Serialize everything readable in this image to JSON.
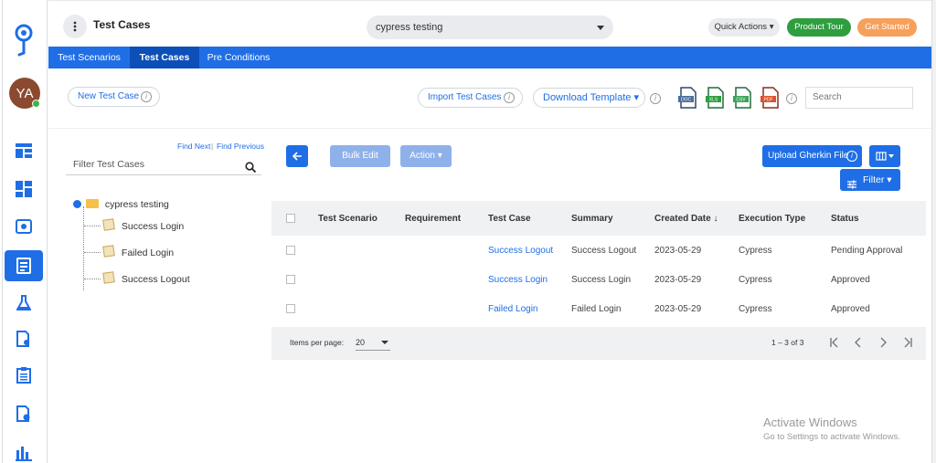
{
  "header": {
    "title": "Test Cases",
    "project": "cypress testing",
    "quick_actions": "Quick Actions",
    "product_tour": "Product Tour",
    "get_started": "Get Started"
  },
  "user": {
    "initials": "YA"
  },
  "sidebar": {
    "items": [
      {
        "icon": "dashboard-icon"
      },
      {
        "icon": "widgets-icon"
      },
      {
        "icon": "settings-gear-icon"
      },
      {
        "icon": "test-cases-icon",
        "active": true
      },
      {
        "icon": "flask-icon"
      },
      {
        "icon": "document-search-icon"
      },
      {
        "icon": "clipboard-icon"
      },
      {
        "icon": "document-settings-icon"
      },
      {
        "icon": "bar-chart-icon"
      }
    ]
  },
  "tabs": [
    {
      "label": "Test Scenarios"
    },
    {
      "label": "Test Cases",
      "active": true
    },
    {
      "label": "Pre Conditions"
    }
  ],
  "toolbar": {
    "new_test_case": "New Test Case",
    "import_test_cases": "Import Test Cases",
    "download_template": "Download Template",
    "search_placeholder": "Search",
    "template_icons": [
      "doc-icon",
      "xlsx-icon",
      "csv-icon",
      "pdf-icon"
    ]
  },
  "tree": {
    "find_next": "Find Next",
    "find_previous": "Find Previous",
    "separator": "|",
    "filter_placeholder": "Filter Test Cases",
    "root": "cypress testing",
    "items": [
      "Success Login",
      "Failed Login",
      "Success Logout"
    ]
  },
  "actions": {
    "bulk_edit": "Bulk Edit",
    "action": "Action",
    "upload_gherkin": "Upload Gherkin File",
    "filter": "Filter"
  },
  "table": {
    "columns": [
      "Test Scenario",
      "Requirement",
      "Test Case",
      "Summary",
      "Created Date",
      "Execution Type",
      "Status"
    ],
    "rows": [
      {
        "scenario": "",
        "requirement": "",
        "test_case": "Success Logout",
        "summary": "Success Logout",
        "created": "2023-05-29",
        "execution": "Cypress",
        "status": "Pending Approval"
      },
      {
        "scenario": "",
        "requirement": "",
        "test_case": "Success Login",
        "summary": "Success Login",
        "created": "2023-05-29",
        "execution": "Cypress",
        "status": "Approved"
      },
      {
        "scenario": "",
        "requirement": "",
        "test_case": "Failed Login",
        "summary": "Failed Login",
        "created": "2023-05-29",
        "execution": "Cypress",
        "status": "Approved"
      }
    ]
  },
  "pager": {
    "items_per_page_label": "Items per page:",
    "page_size": "20",
    "range": "1 – 3 of 3"
  },
  "watermark": {
    "line1": "Activate Windows",
    "line2": "Go to Settings to activate Windows."
  },
  "colors": {
    "primary": "#1f6ee6",
    "tour": "#2e9e3e",
    "get_started": "#f7a05b"
  }
}
